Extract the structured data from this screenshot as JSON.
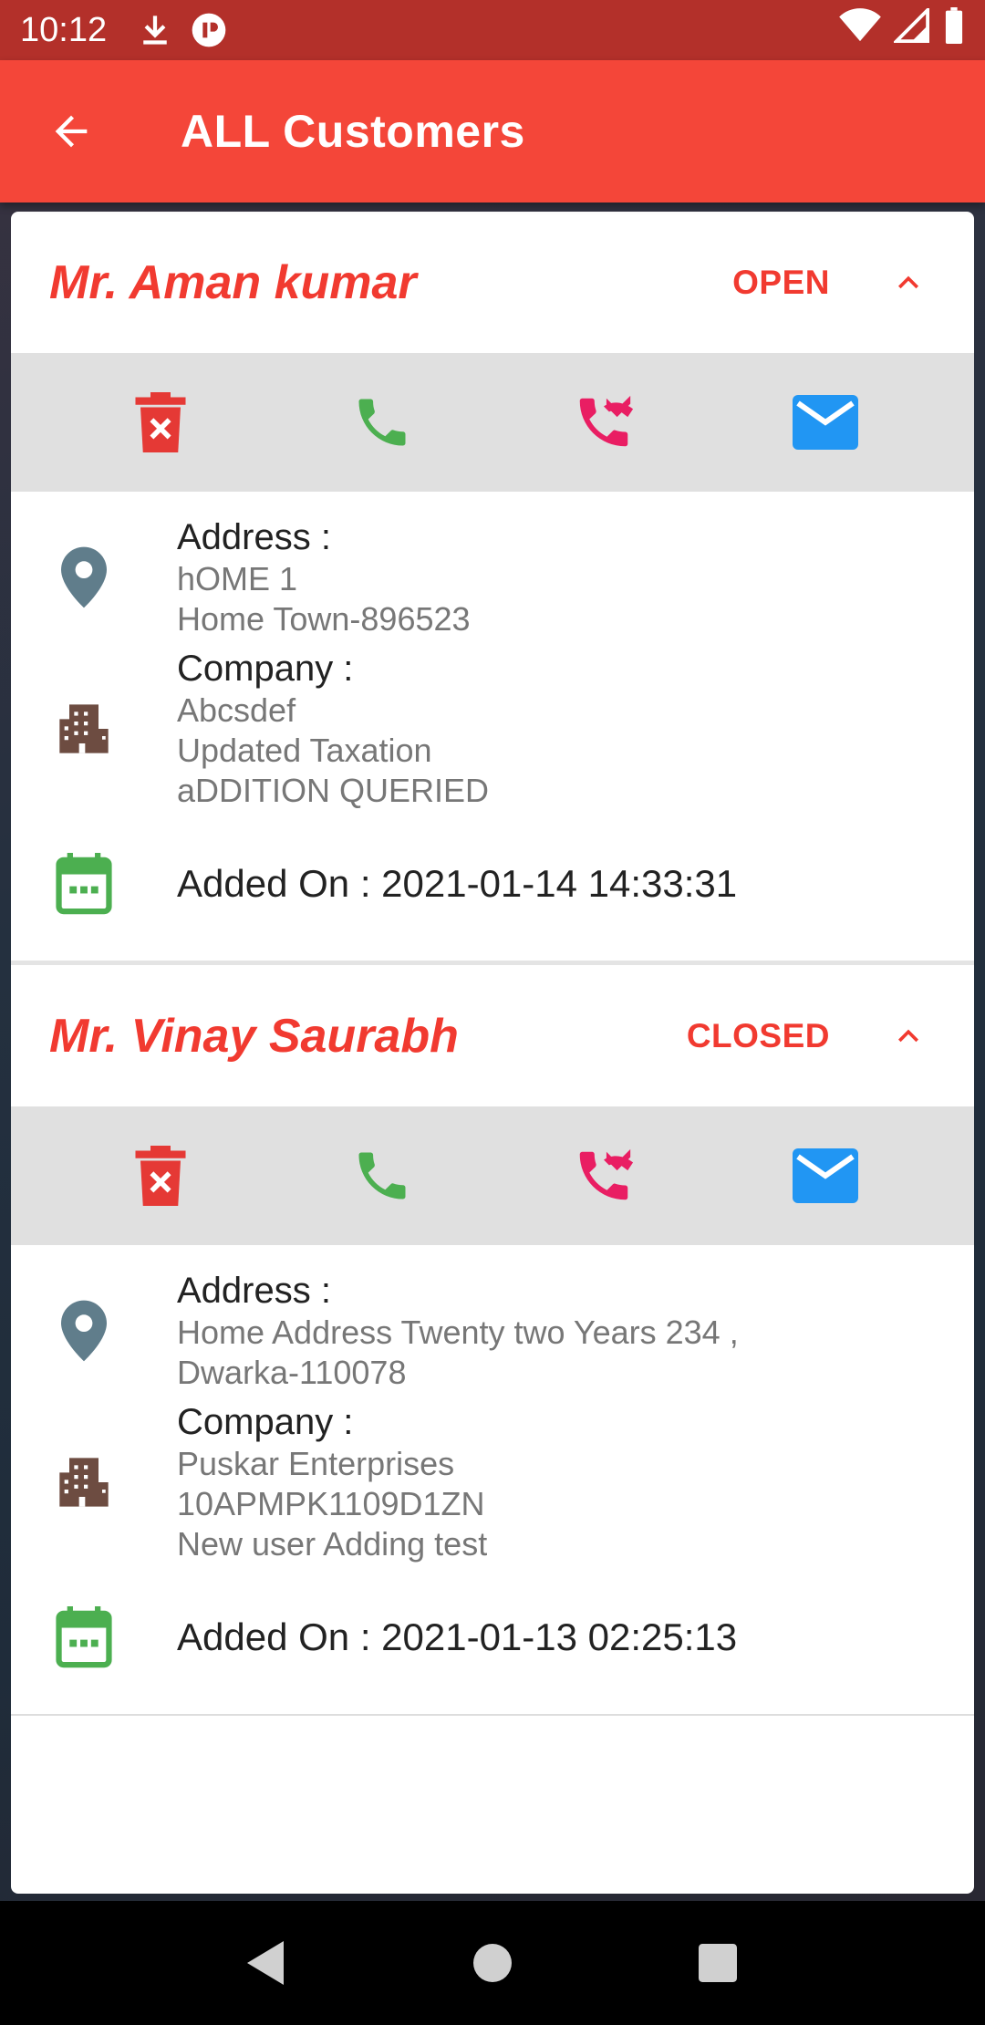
{
  "status_bar": {
    "time": "10:12",
    "icons": [
      "download-icon",
      "app-notification-icon",
      "wifi-icon",
      "signal-icon",
      "battery-icon"
    ]
  },
  "app_bar": {
    "title": "ALL Customers",
    "back_icon": "arrow-back-icon"
  },
  "colors": {
    "app_bar": "#f44639",
    "status_bar": "#b3302a",
    "accent_red": "#f13a30",
    "phone_green": "#4caf50",
    "missed_call_pink": "#e91e63",
    "mail_blue": "#2196f3",
    "calendar_green": "#4caf50",
    "location_gray": "#607d8b",
    "building_brown": "#6d4c41"
  },
  "customers": [
    {
      "name": "Mr. Aman kumar",
      "status": "OPEN",
      "address_label": "Address :",
      "address_line1": "hOME 1",
      "address_line2": "Home Town-896523",
      "company_label": "Company :",
      "company_line1": "Abcsdef",
      "company_line2": "Updated Taxation",
      "company_line3": "aDDITION QUERIED",
      "added_on": "Added On : 2021-01-14 14:33:31"
    },
    {
      "name": "Mr. Vinay Saurabh",
      "status": "CLOSED",
      "address_label": "Address :",
      "address_line1": "Home Address Twenty two Years 234 ,",
      "address_line2": "Dwarka-110078",
      "company_label": "Company :",
      "company_line1": "Puskar Enterprises",
      "company_line2": "10APMPK1109D1ZN",
      "company_line3": "New user Adding test",
      "added_on": "Added On : 2021-01-13 02:25:13"
    }
  ],
  "nav_bar": {
    "icons": [
      "nav-back-icon",
      "nav-home-icon",
      "nav-recents-icon"
    ]
  }
}
